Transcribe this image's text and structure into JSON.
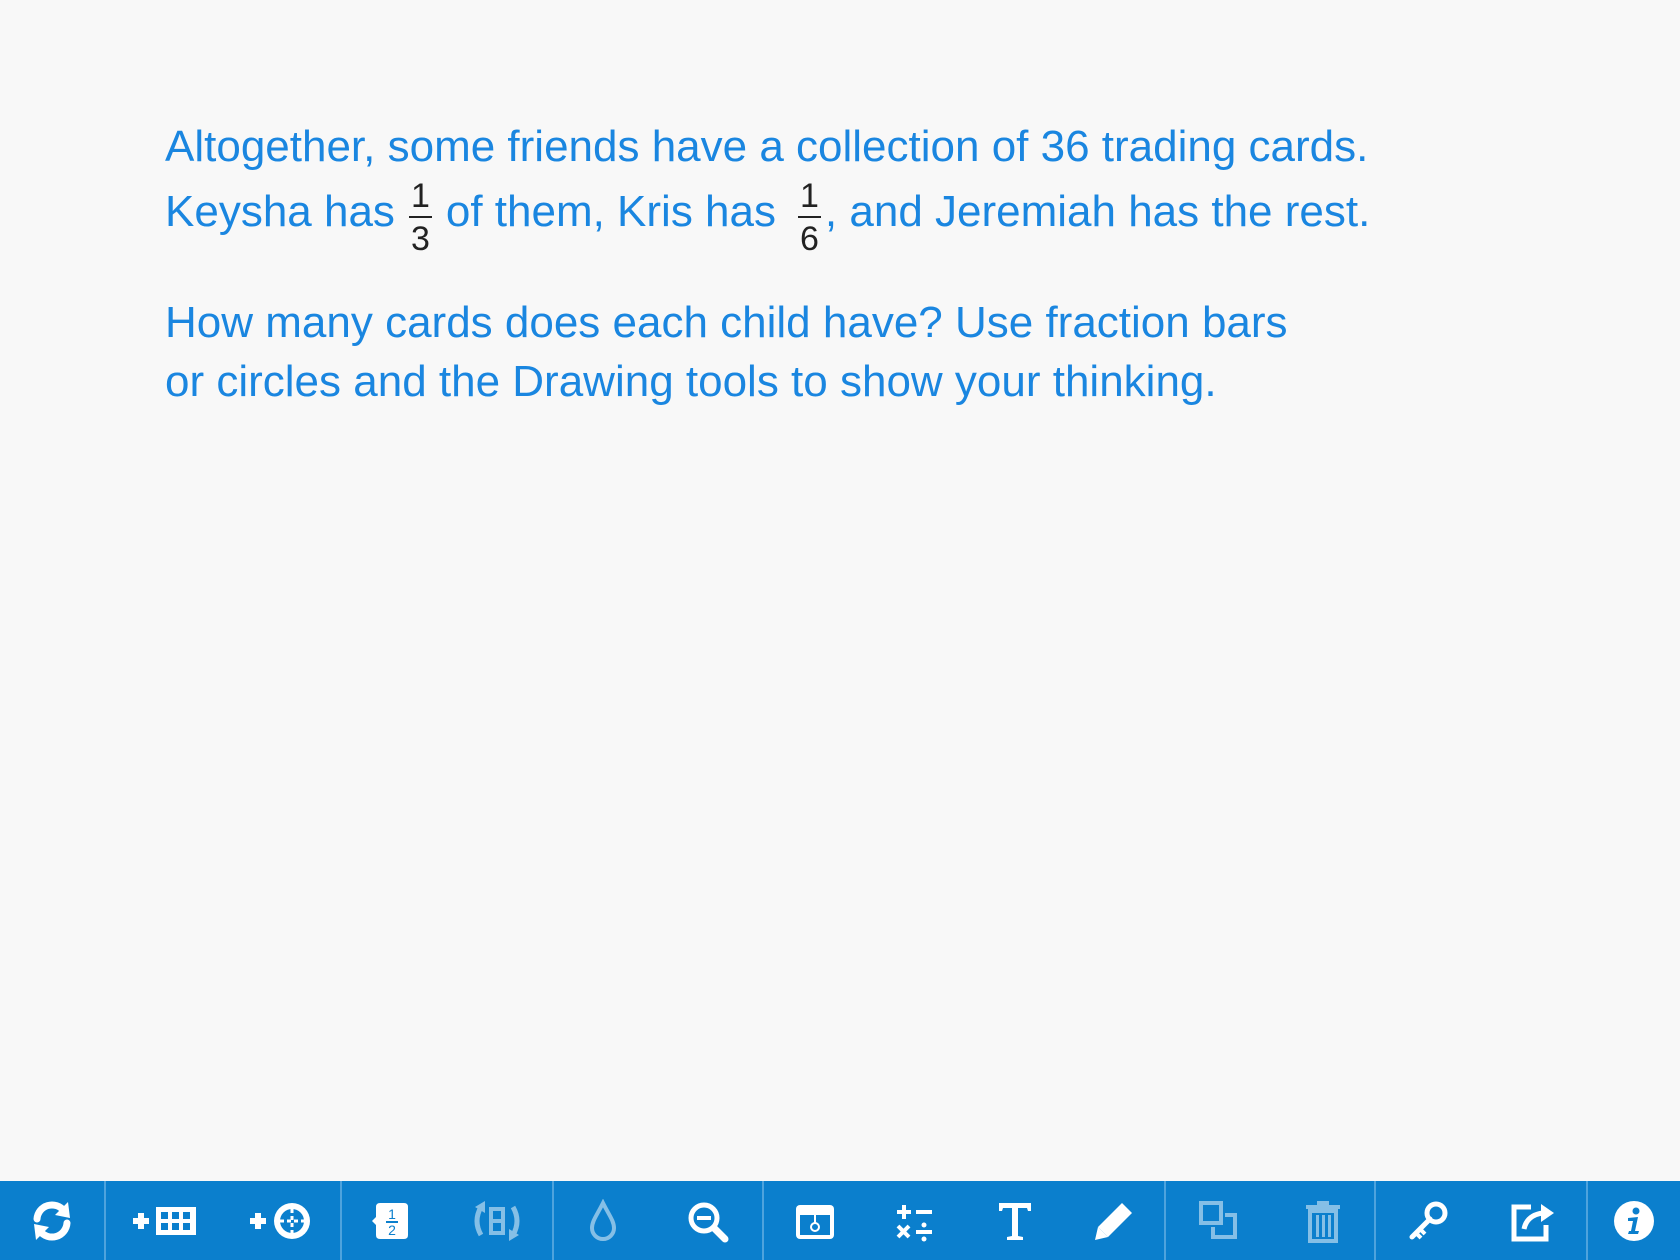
{
  "problem": {
    "line1": "Altogether, some friends have a collection of 36 trading cards.",
    "line2_a": "Keysha has",
    "frac1_num": "1",
    "frac1_den": "3",
    "line2_b": "of them, Kris has",
    "frac2_num": "1",
    "frac2_den": "6",
    "line2_c": ", and Jeremiah has the rest.",
    "question_line1": "How many cards does each child have? Use fraction bars",
    "question_line2": "or circles and the Drawing tools to show your thinking."
  },
  "toolbar": {
    "background": "#0b7fcd",
    "icons": [
      "refresh-icon",
      "add-bar-icon",
      "add-circle-icon",
      "fraction-label-icon",
      "flip-icon",
      "color-drop-icon",
      "zoom-out-icon",
      "fill-tool-icon",
      "math-operators-icon",
      "text-tool-icon",
      "pencil-icon",
      "duplicate-icon",
      "trash-icon",
      "key-icon",
      "share-icon",
      "info-icon"
    ],
    "fraction_icon_num": "1",
    "fraction_icon_den": "2"
  },
  "colors": {
    "prompt_text": "#1a86e0",
    "fraction_text": "#222222",
    "background": "#f8f8f8"
  }
}
